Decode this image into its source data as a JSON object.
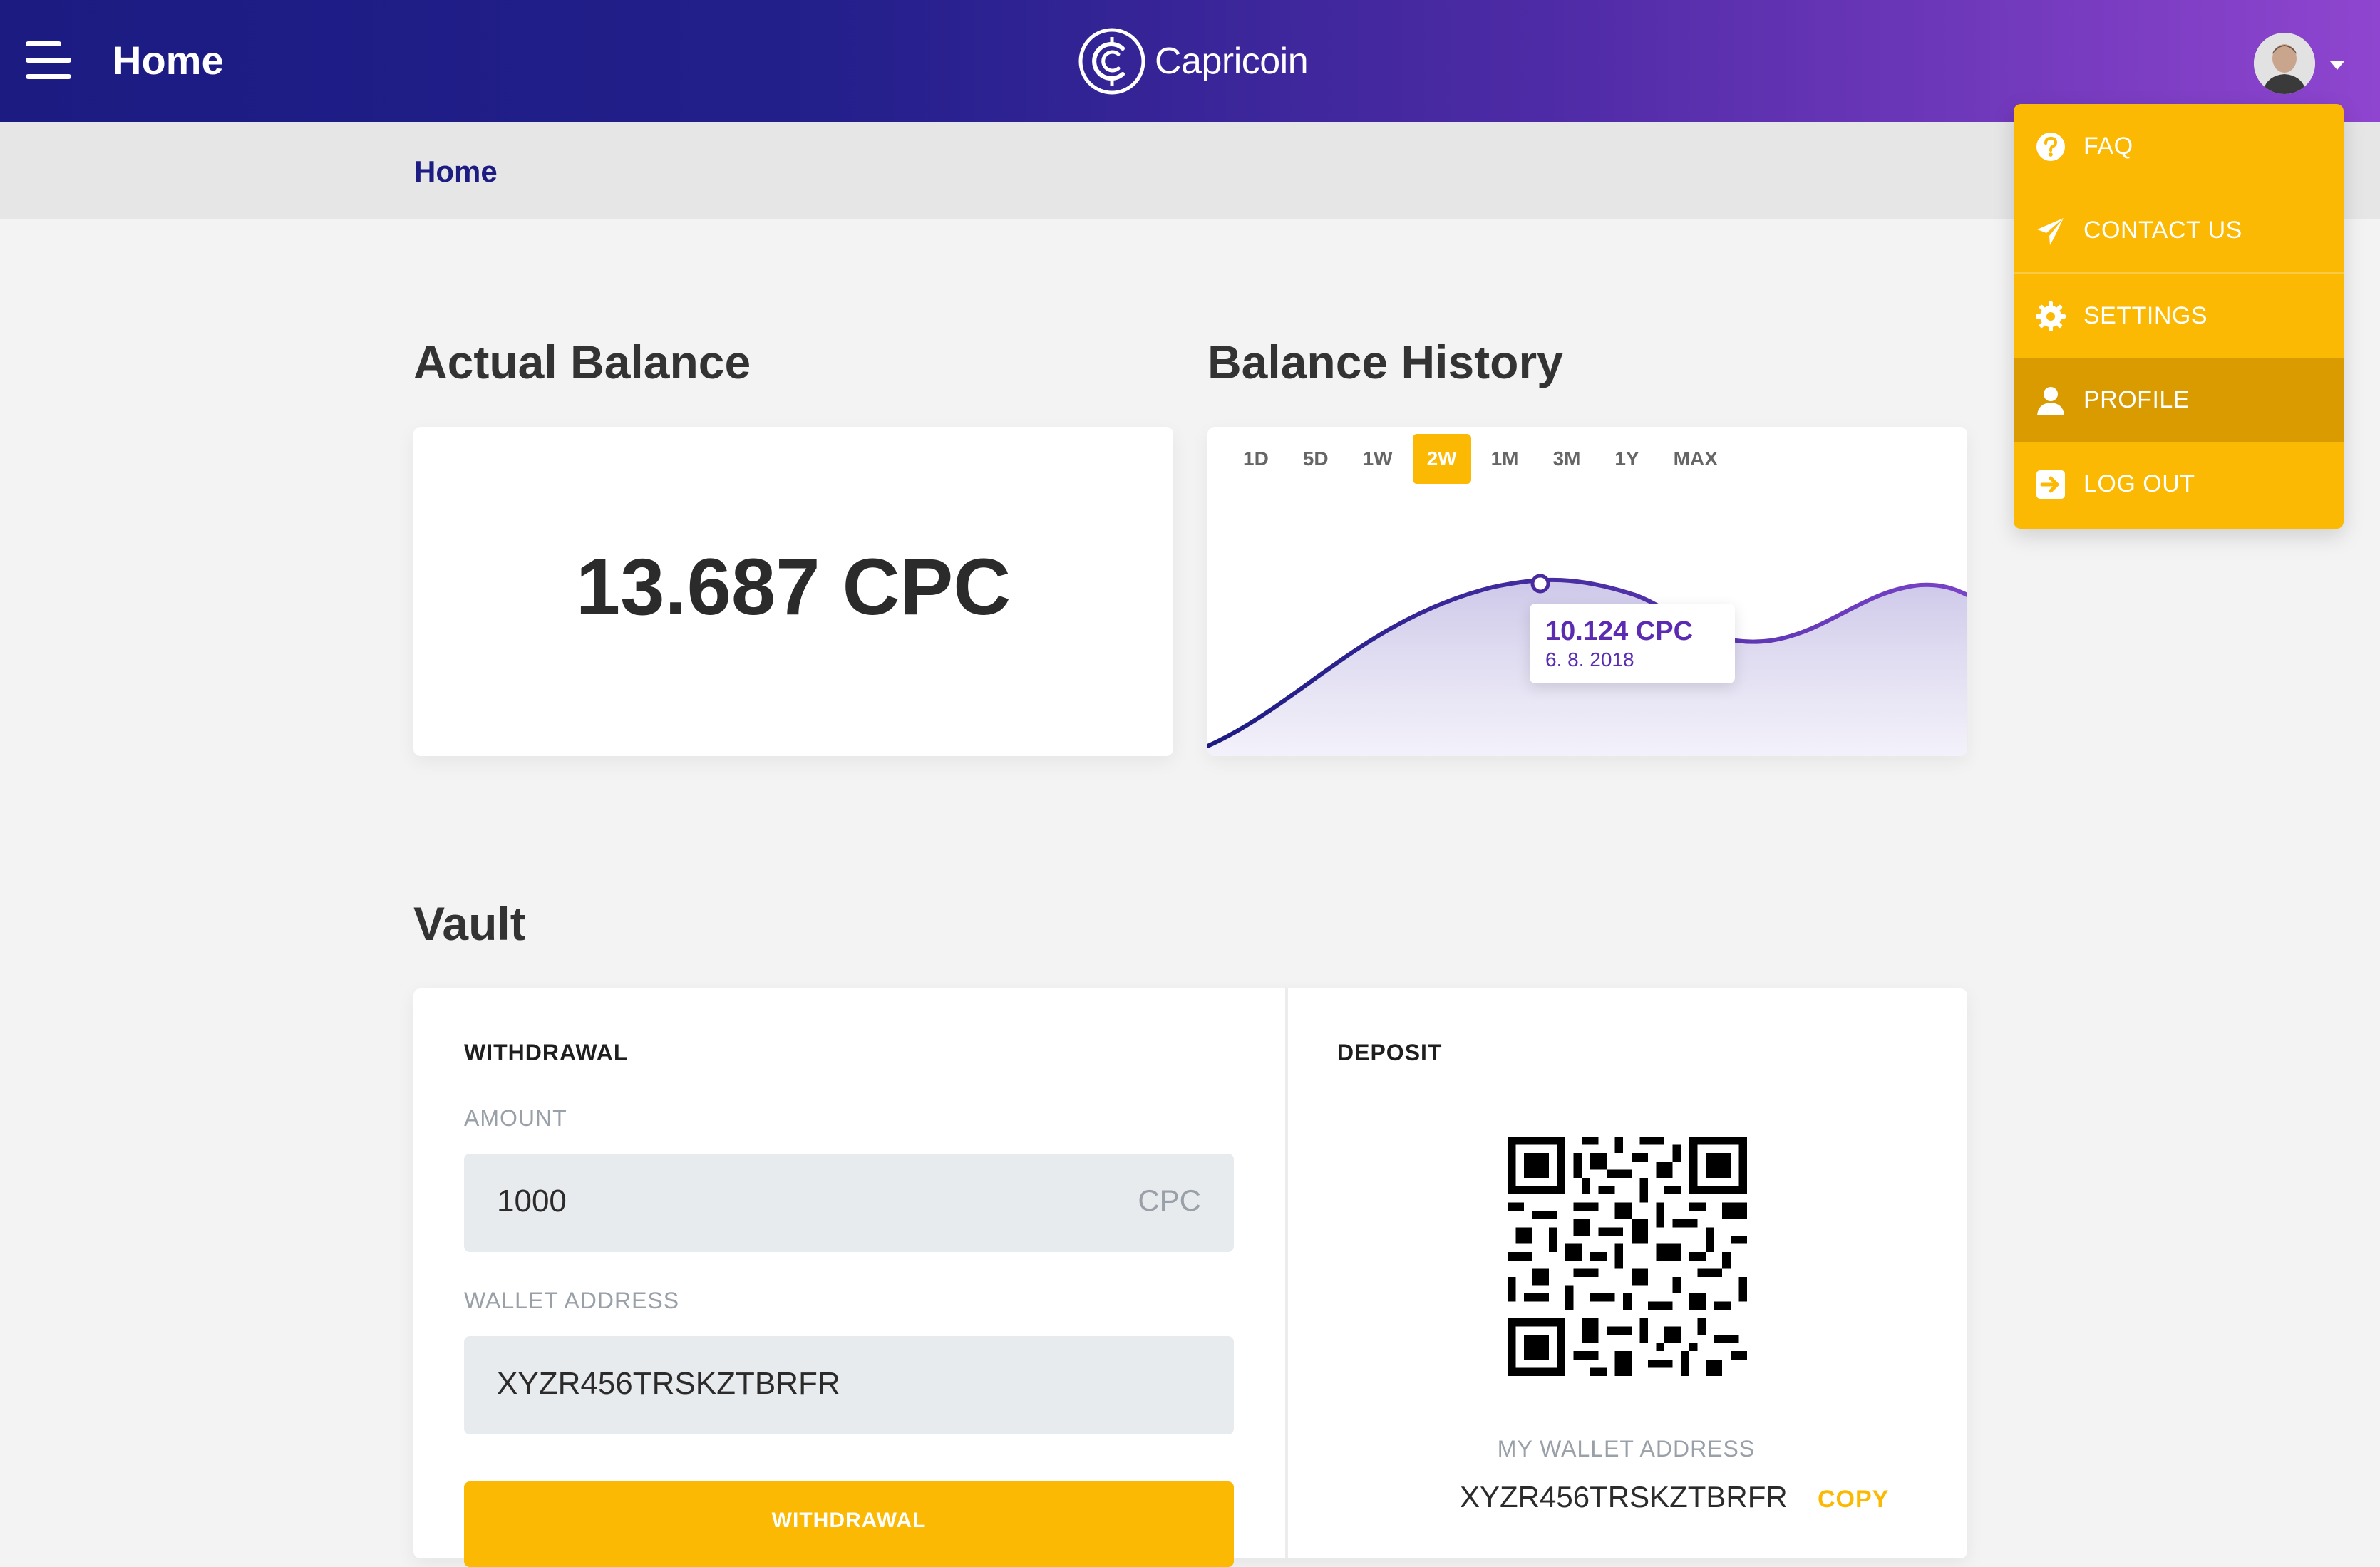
{
  "header": {
    "title": "Home",
    "brand_name": "Capricoin",
    "colors": {
      "gradient_start": "#1b1b82",
      "gradient_end": "#8f45cf"
    }
  },
  "breadcrumb": {
    "current": "Home"
  },
  "balance": {
    "heading": "Actual Balance",
    "value": "13.687 CPC"
  },
  "history": {
    "heading": "Balance History",
    "ranges": [
      "1D",
      "5D",
      "1W",
      "2W",
      "1M",
      "3M",
      "1Y",
      "MAX"
    ],
    "active_range": "2W",
    "tooltip": {
      "value": "10.124 CPC",
      "date": "6. 8. 2018"
    },
    "colors": {
      "line_start": "#1b1b82",
      "line_end": "#7a43c8",
      "active": "#fbb903"
    }
  },
  "vault": {
    "heading": "Vault",
    "withdrawal": {
      "title": "WITHDRAWAL",
      "amount_label": "AMOUNT",
      "amount_value": "1000",
      "amount_suffix": "CPC",
      "wallet_label": "WALLET ADDRESS",
      "wallet_value": "XYZR456TRSKZTBRFR",
      "button_label": "WITHDRAWAL"
    },
    "deposit": {
      "title": "DEPOSIT",
      "my_wallet_label": "MY WALLET ADDRESS",
      "my_wallet_value": "XYZR456TRSKZTBRFR",
      "copy_label": "COPY"
    }
  },
  "user_menu": {
    "items": [
      {
        "label": "FAQ",
        "icon": "question-icon"
      },
      {
        "label": "CONTACT US",
        "icon": "paper-plane-icon"
      },
      {
        "label": "SETTINGS",
        "icon": "gear-icon"
      },
      {
        "label": "PROFILE",
        "icon": "user-icon",
        "highlighted": true
      },
      {
        "label": "LOG OUT",
        "icon": "logout-icon"
      }
    ],
    "colors": {
      "background": "#fbb903",
      "highlight": "#d99b00"
    }
  }
}
